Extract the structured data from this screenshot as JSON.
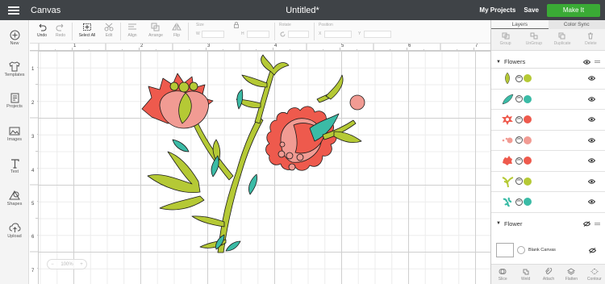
{
  "app": {
    "title": "Canvas",
    "document_title": "Untitled*"
  },
  "header": {
    "my_projects": "My Projects",
    "save": "Save",
    "make_it": "Make It"
  },
  "sidebar": {
    "items": [
      {
        "label": "New",
        "icon": "plus-icon"
      },
      {
        "label": "Templates",
        "icon": "shirt-icon"
      },
      {
        "label": "Projects",
        "icon": "projects-icon"
      },
      {
        "label": "Images",
        "icon": "images-icon"
      },
      {
        "label": "Text",
        "icon": "text-icon"
      },
      {
        "label": "Shapes",
        "icon": "shapes-icon"
      },
      {
        "label": "Upload",
        "icon": "upload-icon"
      }
    ]
  },
  "toolbar": {
    "undo": "Undo",
    "redo": "Redo",
    "select_all": "Select All",
    "edit": "Edit",
    "align": "Align",
    "arrange": "Arrange",
    "flip": "Flip",
    "size": "Size",
    "w": "W",
    "h": "H",
    "rotate": "Rotate",
    "position": "Position",
    "x": "X",
    "y": "Y"
  },
  "rulers": {
    "top": [
      "1",
      "2",
      "3",
      "4",
      "5",
      "6",
      "7"
    ],
    "left": [
      "1",
      "2",
      "3",
      "4",
      "5",
      "6",
      "7"
    ]
  },
  "zoom": {
    "minus": "−",
    "value": "100%",
    "plus": "+"
  },
  "panel": {
    "tabs": [
      "Layers",
      "Color Sync"
    ],
    "tools": [
      "Group",
      "UnGroup",
      "Duplicate",
      "Delete"
    ],
    "group1": "Flowers",
    "layers": [
      {
        "shape": "leaf-icon",
        "color": "#b5c935"
      },
      {
        "shape": "leaf-icon",
        "color": "#3bbba6"
      },
      {
        "shape": "flower-piece-icon",
        "color": "#ee5a4d"
      },
      {
        "shape": "dots-icon",
        "color": "#f19b93"
      },
      {
        "shape": "flower-icon",
        "color": "#ee5a4d"
      },
      {
        "shape": "stem-icon",
        "color": "#b5c935"
      },
      {
        "shape": "branch-icon",
        "color": "#3bbba6"
      }
    ],
    "group2": "Flower",
    "blank_canvas": "Blank Canvas",
    "bottom_tools": [
      "Slice",
      "Weld",
      "Attach",
      "Flatten",
      "Contour"
    ]
  },
  "colors": {
    "coral": "#ee5a4d",
    "pink": "#f19b93",
    "green": "#b5c935",
    "teal": "#3bbba6",
    "make_it": "#3aaa35"
  }
}
